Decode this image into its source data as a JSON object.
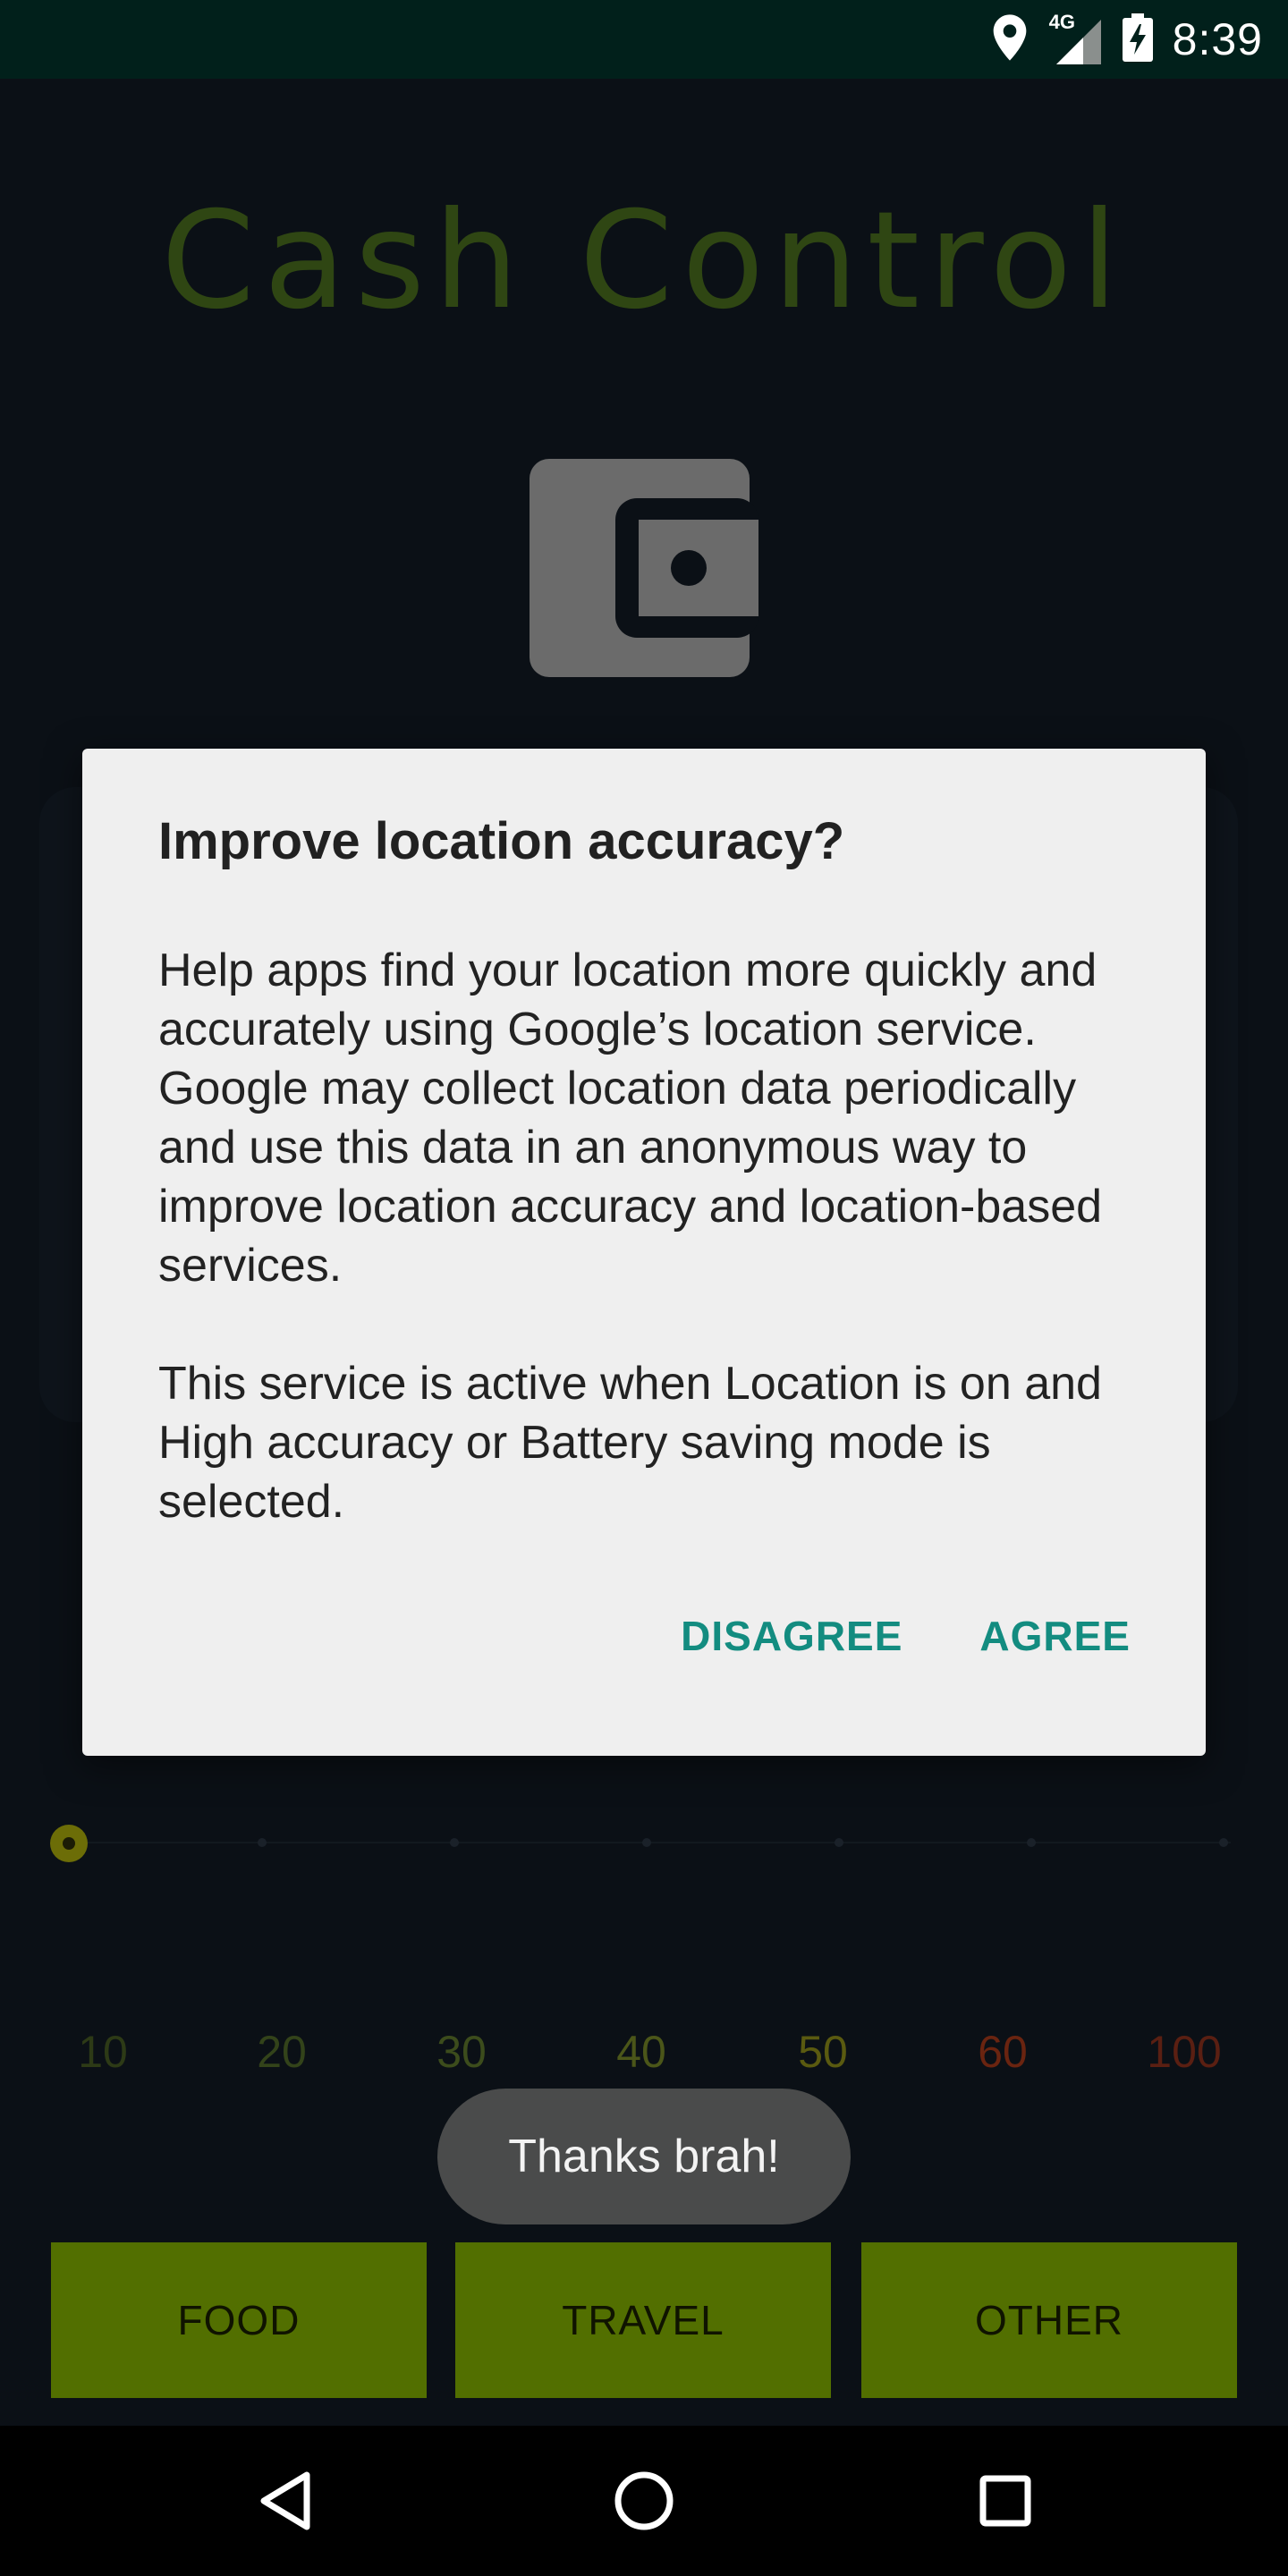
{
  "status_bar": {
    "time": "8:39",
    "network_label": "4G",
    "icons": [
      "location-icon",
      "signal-icon",
      "battery-charging-icon"
    ]
  },
  "app": {
    "title": "Cash Control",
    "title_color": "#2f4613",
    "scale_labels": [
      {
        "text": "10",
        "color": "#2d3a16"
      },
      {
        "text": "20",
        "color": "#33431a"
      },
      {
        "text": "30",
        "color": "#3c4c1c"
      },
      {
        "text": "40",
        "color": "#4b5619"
      },
      {
        "text": "50",
        "color": "#5a5a10"
      },
      {
        "text": "60",
        "color": "#6a2410"
      },
      {
        "text": "100",
        "color": "#5a1f12"
      }
    ],
    "slider_value": "10",
    "toast": "Thanks brah!",
    "categories": [
      "FOOD",
      "TRAVEL",
      "OTHER"
    ],
    "category_color": "#526f00"
  },
  "dialog": {
    "title": "Improve location accuracy?",
    "paragraph1": "Help apps find your location more quickly and accurately using Google’s location service. Google may collect location data periodically and use this data in an anonymous way to improve location accuracy and location-based services.",
    "paragraph2": "This service is active when Location is on and High accuracy or Battery saving mode is selected.",
    "disagree_label": "DISAGREE",
    "agree_label": "AGREE",
    "accent_color": "#138c80"
  },
  "nav_bar": {
    "icons": [
      "back-icon",
      "home-icon",
      "recents-icon"
    ]
  }
}
